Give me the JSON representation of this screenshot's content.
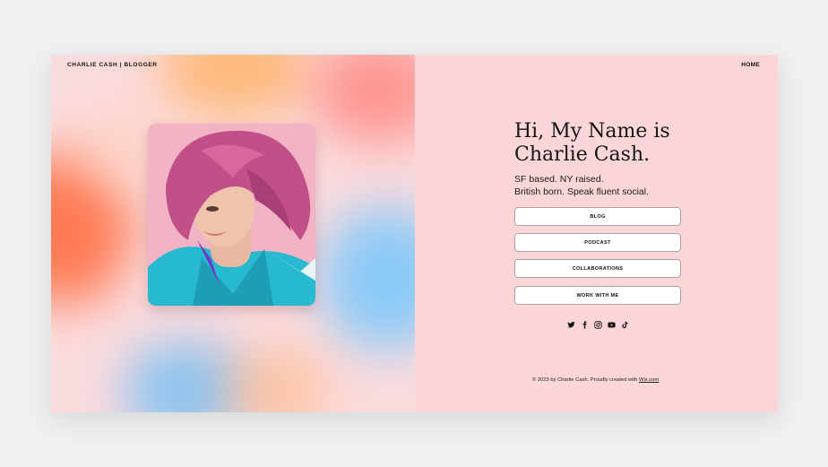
{
  "header": {
    "brand": "CHARLIE CASH | BLOGGER",
    "nav_home": "HOME"
  },
  "hero": {
    "headline_line1": "Hi, My Name is",
    "headline_line2": "Charlie Cash.",
    "subtext_line1": "SF based. NY raised.",
    "subtext_line2": "British born. Speak fluent social."
  },
  "menu": [
    {
      "label": "BLOG"
    },
    {
      "label": "PODCAST"
    },
    {
      "label": "COLLABORATIONS"
    },
    {
      "label": "WORK WITH ME"
    }
  ],
  "socials": [
    "twitter-icon",
    "facebook-icon",
    "instagram-icon",
    "youtube-icon",
    "tiktok-icon"
  ],
  "footer": {
    "text": "© 2023 by Charlie Cash. Proudly created with ",
    "link": "Wix.com"
  },
  "colors": {
    "right_bg": "#fad6d9",
    "page_bg": "#eef0f1",
    "hair": "#c24f88",
    "jacket": "#27b9cf"
  }
}
